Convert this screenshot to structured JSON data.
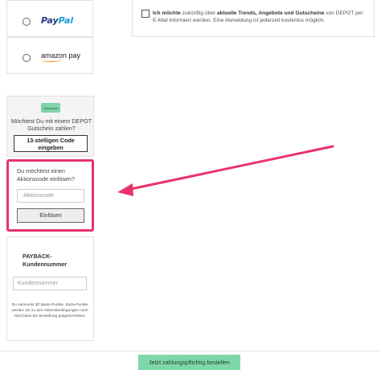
{
  "payment_options": {
    "paypal_logo": {
      "part1": "Pay",
      "part2": "Pal"
    },
    "amazon_logo": "amazon pay"
  },
  "gift_card": {
    "badge": "Gutschein",
    "question": "Möchtest Du mit einem DEPOT Gutschein zahlen?",
    "button": "13-stelligen Code eingeben"
  },
  "promo": {
    "label": "Du möchtest einen Aktionscode einlösen?",
    "placeholder": "Aktionscode",
    "button": "Einlösen",
    "highlight_color": "#e8336b"
  },
  "payback": {
    "title": "PAYBACK-Kundennummer",
    "placeholder": "Kundennummer",
    "info_prefix": "Du sammelst ",
    "points": "17",
    "info_suffix": " Basis-Punkte. Extra-Punkte werden Dir zu den Aktionsbedingungen nach Abschluss der Bestellung gutgeschrieben."
  },
  "newsletter": {
    "part1": "Ich möchte",
    "part2": " zukünftig über ",
    "part3": "aktuelle Trends, Angebote und Gutscheine",
    "part4": " von DEPOT per E-Mail informiert werden. Eine Abmeldung ist jederzeit kostenlos möglich."
  },
  "order_button": "Jetzt zahlungspflichtig bestellen",
  "colors": {
    "accent_green": "#7fd8a8",
    "annotation_arrow": "#e8336b"
  }
}
